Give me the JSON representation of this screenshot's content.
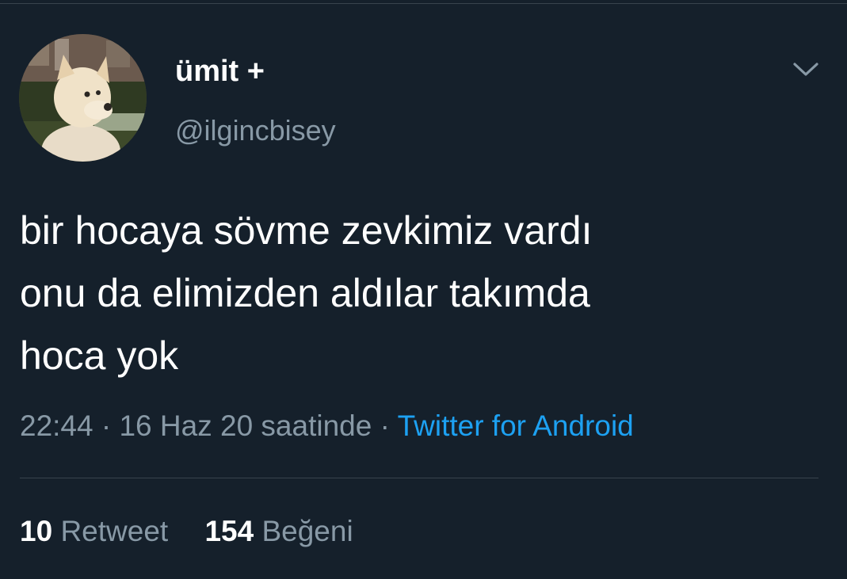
{
  "tweet": {
    "author": {
      "display_name": "ümit +",
      "handle": "@ilgincbisey",
      "avatar_icon": "dog-avatar"
    },
    "menu_icon": "chevron-down-icon",
    "text_lines": [
      "bir hocaya sövme zevkimiz vardı",
      "onu da elimizden aldılar takımda",
      "hoca yok"
    ],
    "time": "22:44",
    "separator": "·",
    "date": "16 Haz 20 saatinde",
    "source": "Twitter for Android",
    "retweets": {
      "count": "10",
      "label": "Retweet"
    },
    "likes": {
      "count": "154",
      "label": "Beğeni"
    }
  },
  "colors": {
    "background": "#15202b",
    "primary_text": "#ffffff",
    "secondary_text": "#8899a6",
    "link": "#1da1f2",
    "divider": "#38444d"
  }
}
